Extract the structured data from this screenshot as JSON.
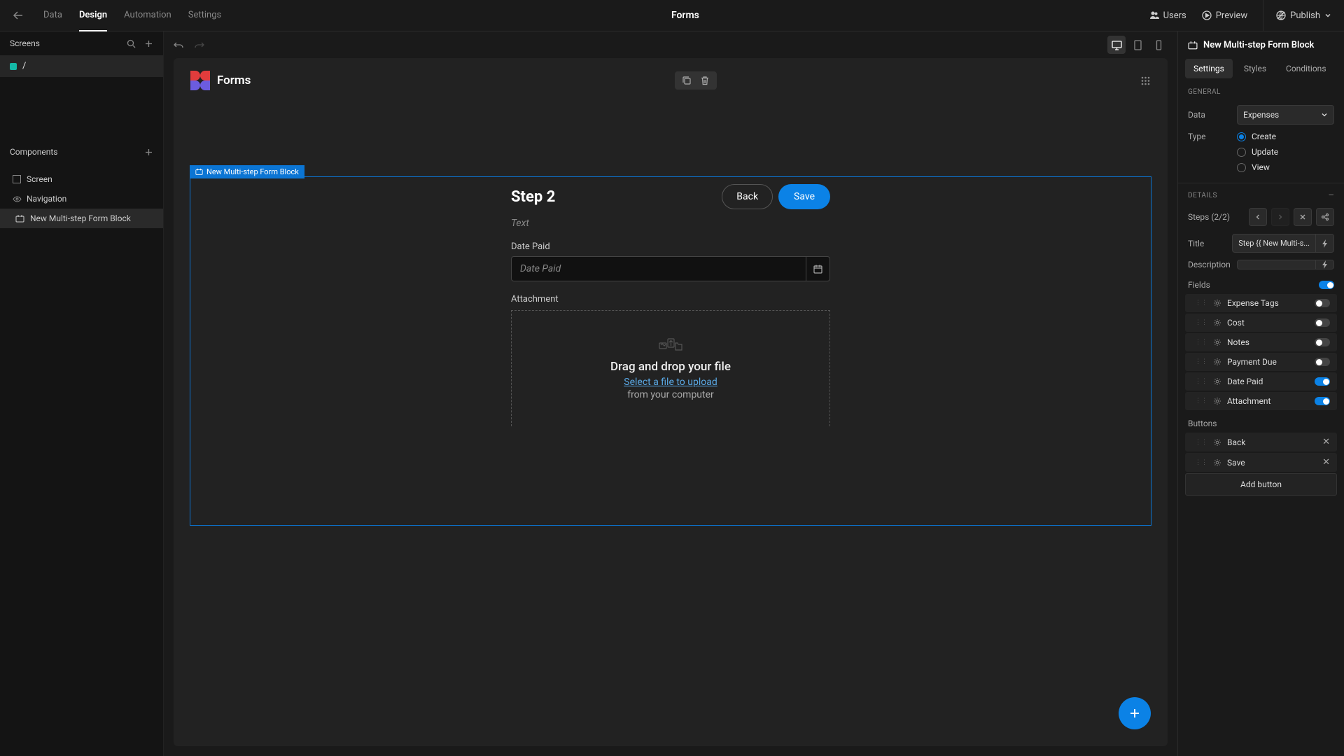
{
  "topbar": {
    "tabs": [
      "Data",
      "Design",
      "Automation",
      "Settings"
    ],
    "active_tab": "Design",
    "title": "Forms",
    "users": "Users",
    "preview": "Preview",
    "publish": "Publish"
  },
  "left": {
    "screens_header": "Screens",
    "screen_name": "/",
    "components_header": "Components",
    "items": [
      {
        "label": "Screen",
        "icon": "screen"
      },
      {
        "label": "Navigation",
        "icon": "nav"
      },
      {
        "label": "New Multi-step Form Block",
        "icon": "form",
        "selected": true
      }
    ]
  },
  "canvas": {
    "app_title": "Forms",
    "selected_tag": "New Multi-step Form Block",
    "step_title": "Step 2",
    "step_text": "Text",
    "back_label": "Back",
    "save_label": "Save",
    "date_label": "Date Paid",
    "date_placeholder": "Date Paid",
    "attach_label": "Attachment",
    "dz_main": "Drag and drop your file",
    "dz_link": "Select a file to upload",
    "dz_sub": "from your computer"
  },
  "right": {
    "block_title": "New Multi-step Form Block",
    "tabs": [
      "Settings",
      "Styles",
      "Conditions"
    ],
    "active_tab": "Settings",
    "general_h": "GENERAL",
    "data_label": "Data",
    "data_value": "Expenses",
    "type_label": "Type",
    "type_options": [
      "Create",
      "Update",
      "View"
    ],
    "type_selected": "Create",
    "details_h": "DETAILS",
    "steps_label": "Steps (2/2)",
    "title_label": "Title",
    "title_value": "Step {{ New Multi-s...",
    "desc_label": "Description",
    "desc_value": "",
    "fields_label": "Fields",
    "fields": [
      {
        "name": "Expense Tags",
        "on": false
      },
      {
        "name": "Cost",
        "on": false
      },
      {
        "name": "Notes",
        "on": false
      },
      {
        "name": "Payment Due",
        "on": false
      },
      {
        "name": "Date Paid",
        "on": true
      },
      {
        "name": "Attachment",
        "on": true
      }
    ],
    "buttons_label": "Buttons",
    "buttons": [
      "Back",
      "Save"
    ],
    "add_button": "Add button"
  }
}
